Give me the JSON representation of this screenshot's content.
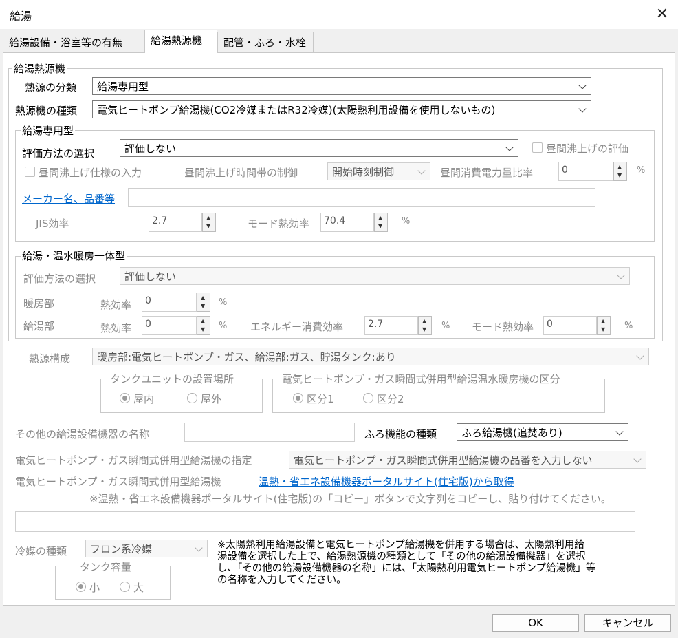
{
  "window": {
    "title": "給湯",
    "close_glyph": "✕"
  },
  "tabs": [
    "給湯設備・浴室等の有無",
    "給湯熱源機",
    "配管・ふろ・水栓"
  ],
  "heat_source": {
    "legend": "給湯熱源機",
    "category_label": "熱源の分類",
    "category_value": "給湯専用型",
    "type_label": "熱源機の種類",
    "type_value": "電気ヒートポンプ給湯機(CO2冷媒またはR32冷媒)(太陽熱利用設備を使用しないもの)"
  },
  "dedicated": {
    "legend": "給湯専用型",
    "eval_label": "評価方法の選択",
    "eval_value": "評価しない",
    "daytime_eval_label": "昼間沸上げの評価",
    "daytime_spec_label": "昼間沸上げ仕様の入力",
    "daytime_control_label": "昼間沸上げ時間帯の制御",
    "daytime_control_value": "開始時刻制御",
    "daytime_power_label": "昼間消費電力量比率",
    "daytime_power_value": "0",
    "pct": "%",
    "maker_link": "メーカー名、品番等",
    "maker_value": "",
    "jis_label": "JIS効率",
    "jis_value": "2.7",
    "mode_label": "モード熱効率",
    "mode_value": "70.4"
  },
  "integrated": {
    "legend": "給湯・温水暖房一体型",
    "eval_label": "評価方法の選択",
    "eval_value": "評価しない",
    "heating_label": "暖房部",
    "heating_eff_label": "熱効率",
    "heating_eff_value": "0",
    "hotwater_label": "給湯部",
    "hotwater_eff_label": "熱効率",
    "hotwater_eff_value": "0",
    "energy_label": "エネルギー消費効率",
    "energy_value": "2.7",
    "mode_label": "モード熱効率",
    "mode_value": "0",
    "pct": "%"
  },
  "config": {
    "label": "熱源構成",
    "value": "暖房部:電気ヒートポンプ・ガス、給湯部:ガス、貯湯タンク:あり"
  },
  "tank_unit": {
    "legend": "タンクユニットの設置場所",
    "indoor": "屋内",
    "outdoor": "屋外"
  },
  "hybrid_class": {
    "legend": "電気ヒートポンプ・ガス瞬間式併用型給湯温水暖房機の区分",
    "class1": "区分1",
    "class2": "区分2"
  },
  "other": {
    "name_label": "その他の給湯設備機器の名称",
    "name_value": "",
    "bath_label": "ふろ機能の種類",
    "bath_value": "ふろ給湯機(追焚あり)"
  },
  "hybrid": {
    "spec_label": "電気ヒートポンプ・ガス瞬間式併用型給湯機の指定",
    "spec_value": "電気ヒートポンプ・ガス瞬間式併用型給湯機の品番を入力しない",
    "portal_label": "電気ヒートポンプ・ガス瞬間式併用型給湯機",
    "portal_link": "温熱・省エネ設備機器ポータルサイト(住宅版)から取得",
    "portal_note": "※温熱・省エネ設備機器ポータルサイト(住宅版)の「コピー」ボタンで文字列をコピーし、貼り付けてください。",
    "paste_value": ""
  },
  "refrigerant": {
    "label": "冷媒の種類",
    "value": "フロン系冷媒"
  },
  "tank_capacity": {
    "legend": "タンク容量",
    "small": "小",
    "large": "大"
  },
  "notice_lines": [
    "※太陽熱利用給湯設備と電気ヒートポンプ給湯機を併用する場合は、太陽熱利用給",
    "湯設備を選択した上で、給湯熱源機の種類として「その他の給湯設備機器」を選択",
    "し、「その他の給湯設備機器の名称」には、「太陽熱利用電気ヒートポンプ給湯機」等",
    "の名称を入力してください。"
  ],
  "buttons": {
    "ok": "OK",
    "cancel": "キャンセル"
  }
}
